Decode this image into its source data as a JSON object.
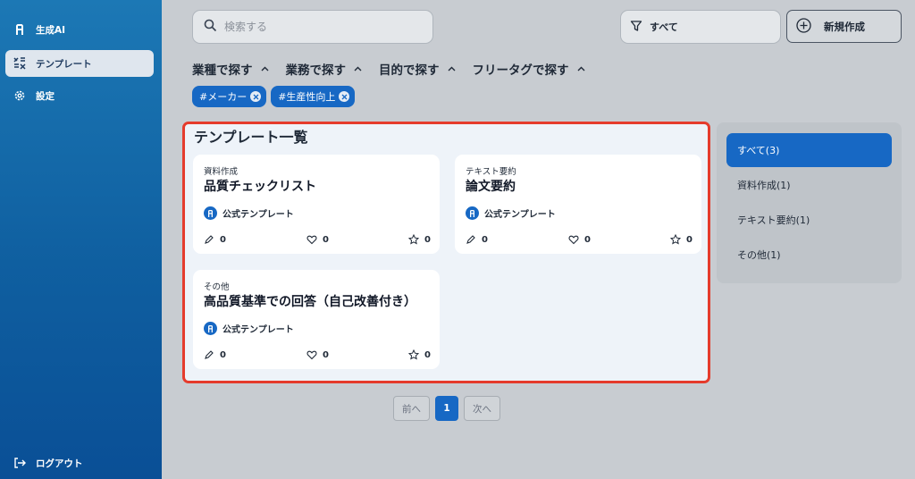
{
  "sidebar": {
    "items": [
      {
        "label": "生成AI",
        "icon": "app-logo-icon"
      },
      {
        "label": "テンプレート",
        "icon": "template-grid-icon"
      },
      {
        "label": "設定",
        "icon": "gear-icon"
      }
    ],
    "logout": {
      "label": "ログアウト",
      "icon": "logout-icon"
    }
  },
  "search": {
    "placeholder": "検索する"
  },
  "filter": {
    "label": "すべて"
  },
  "new_button": {
    "label": "新規作成"
  },
  "categories": [
    {
      "label": "業種で探す"
    },
    {
      "label": "業務で探す"
    },
    {
      "label": "目的で探す"
    },
    {
      "label": "フリータグで探す"
    }
  ],
  "chips": [
    {
      "label": "#メーカー"
    },
    {
      "label": "#生産性向上"
    }
  ],
  "panel": {
    "title": "テンプレート一覧",
    "cards": [
      {
        "category": "資料作成",
        "title": "品質チェックリスト",
        "badge": "公式テンプレート",
        "edits": "0",
        "likes": "0",
        "stars": "0"
      },
      {
        "category": "テキスト要約",
        "title": "論文要約",
        "badge": "公式テンプレート",
        "edits": "0",
        "likes": "0",
        "stars": "0"
      },
      {
        "category": "その他",
        "title": "高品質基準での回答（自己改善付き）",
        "badge": "公式テンプレート",
        "edits": "0",
        "likes": "0",
        "stars": "0"
      }
    ]
  },
  "category_list": [
    {
      "label": "すべて(3)"
    },
    {
      "label": "資料作成(1)"
    },
    {
      "label": "テキスト要約(1)"
    },
    {
      "label": "その他(1)"
    }
  ],
  "pagination": {
    "prev": "前へ",
    "current": "1",
    "next": "次へ"
  },
  "colors": {
    "accent": "#1768c4",
    "highlight_border": "#e53b2c",
    "sidebar": "#0f5fa0"
  }
}
